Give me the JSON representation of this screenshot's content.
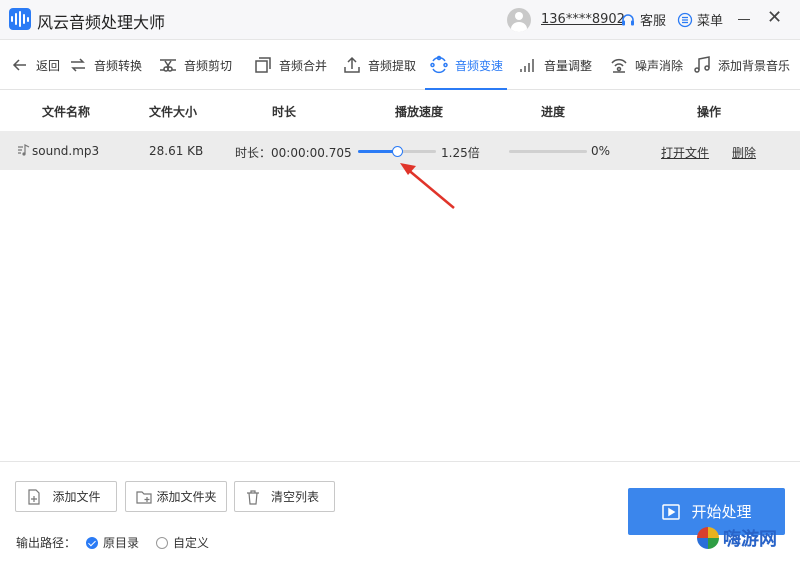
{
  "app": {
    "title": "风云音频处理大师"
  },
  "header": {
    "account": "136****8902",
    "service_label": "客服",
    "menu_label": "菜单"
  },
  "toolbar": {
    "back": "返回",
    "tools": [
      "音频转换",
      "音频剪切",
      "音频合并",
      "音频提取",
      "音频变速",
      "音量调整",
      "噪声消除",
      "添加背景音乐"
    ],
    "active": "音频变速"
  },
  "table": {
    "headers": [
      "文件名称",
      "文件大小",
      "时长",
      "播放速度",
      "进度",
      "操作"
    ],
    "rows": [
      {
        "name": "sound.mp3",
        "size": "28.61 KB",
        "duration": "时长：00:00:00.705",
        "speed_value": 1.25,
        "speed_label": "1.25倍",
        "progress_label": "0%",
        "progress_value": 0,
        "open_label": "打开文件",
        "delete_label": "删除"
      }
    ]
  },
  "bottom": {
    "add_file": "添加文件",
    "add_folder": "添加文件夹",
    "clear_list": "清空列表",
    "output_label": "输出路径：",
    "option_original": "原目录",
    "option_custom": "自定义",
    "selected": "原目录",
    "start_label": "开始处理"
  },
  "watermark": {
    "text": "嗨游网"
  },
  "colors": {
    "accent": "#2b7bf5",
    "row_bg": "#ececec",
    "arrow": "#e0342a"
  }
}
